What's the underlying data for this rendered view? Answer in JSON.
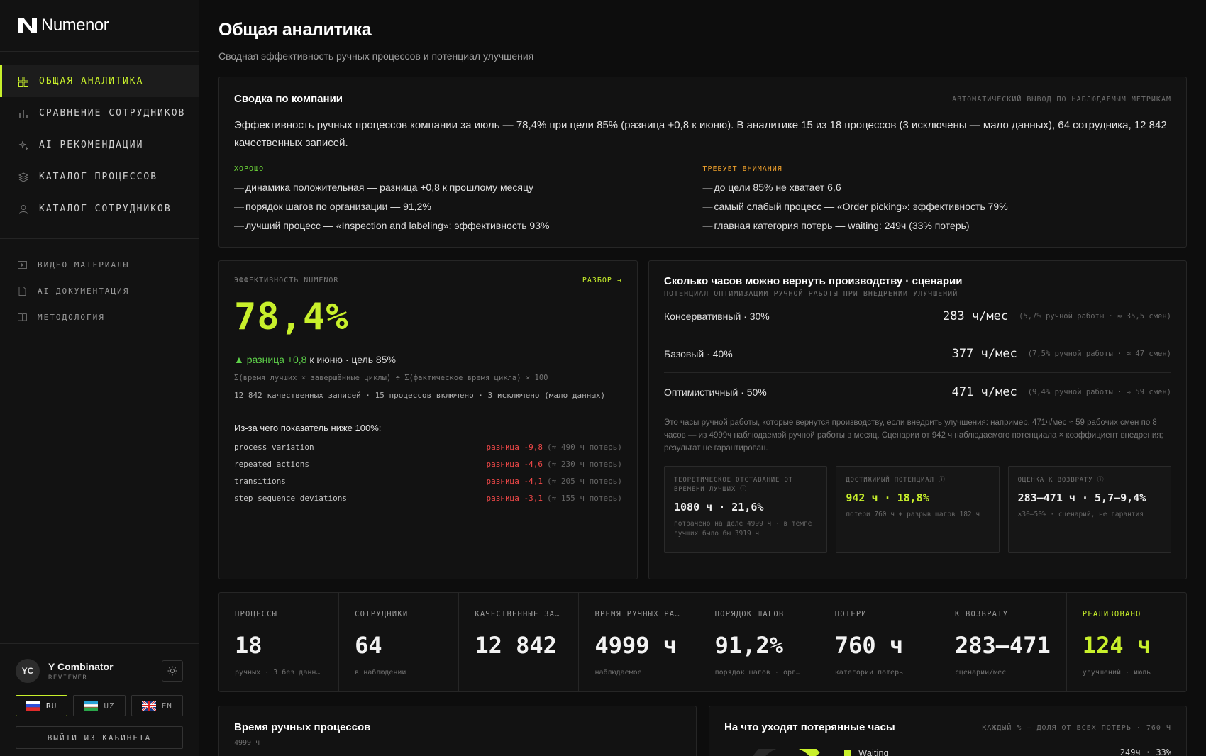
{
  "app": {
    "name": "Numenor"
  },
  "sidebar": {
    "nav": [
      {
        "label": "ОБЩАЯ АНАЛИТИКА",
        "icon": "grid-icon"
      },
      {
        "label": "СРАВНЕНИЕ СОТРУДНИКОВ",
        "icon": "bar-chart-icon"
      },
      {
        "label": "AI РЕКОМЕНДАЦИИ",
        "icon": "sparkle-icon"
      },
      {
        "label": "КАТАЛОГ ПРОЦЕССОВ",
        "icon": "layers-icon"
      },
      {
        "label": "КАТАЛОГ СОТРУДНИКОВ",
        "icon": "user-icon"
      }
    ],
    "sub": [
      {
        "label": "ВИДЕО МАТЕРИАЛЫ",
        "icon": "video-icon"
      },
      {
        "label": "AI ДОКУМЕНТАЦИЯ",
        "icon": "document-icon"
      },
      {
        "label": "МЕТОДОЛОГИЯ",
        "icon": "book-icon"
      }
    ],
    "user": {
      "initials": "YC",
      "name": "Y Combinator",
      "role": "REVIEWER"
    },
    "langs": [
      "RU",
      "UZ",
      "EN"
    ],
    "logout": "ВЫЙТИ ИЗ КАБИНЕТА"
  },
  "page": {
    "title": "Общая аналитика",
    "subtitle": "Сводная эффективность ручных процессов и потенциал улучшения"
  },
  "summary": {
    "title": "Сводка по компании",
    "tag": "АВТОМАТИЧЕСКИЙ ВЫВОД ПО НАБЛЮДАЕМЫМ МЕТРИКАМ",
    "text": "Эффективность ручных процессов компании за июль — 78,4% при цели 85% (разница +0,8 к июню). В аналитике 15 из 18 процессов (3 исключены — мало данных), 64 сотрудника, 12 842 качественных записей.",
    "good_title": "ХОРОШО",
    "good": [
      "динамика положительная — разница +0,8 к прошлому месяцу",
      "порядок шагов по организации — 91,2%",
      "лучший процесс — «Inspection and labeling»: эффективность 93%"
    ],
    "warn_title": "ТРЕБУЕТ ВНИМАНИЯ",
    "warn": [
      "до цели 85% не хватает 6,6",
      "самый слабый процесс — «Order picking»: эффективность 79%",
      "главная категория потерь — waiting: 249ч (33% потерь)"
    ]
  },
  "efficiency": {
    "label": "ЭФФЕКТИВНОСТЬ NUMENOR",
    "link": "РАЗБОР →",
    "value": "78,4%",
    "delta_arrow": "▲",
    "delta_text": "разница +0,8",
    "delta_rest": " к июню · цель 85%",
    "formula": "Σ(время лучших × завершённые циклы) ÷ Σ(фактическое время цикла) × 100",
    "meta": "12 842 качественных записей · 15 процессов включено · 3 исключено (мало данных)",
    "why_title": "Из-за чего показатель ниже 100%:",
    "why": [
      {
        "name": "process variation",
        "value": "разница -9,8",
        "note": "(≈ 490 ч потерь)"
      },
      {
        "name": "repeated actions",
        "value": "разница -4,6",
        "note": "(≈ 230 ч потерь)"
      },
      {
        "name": "transitions",
        "value": "разница -4,1",
        "note": "(≈ 205 ч потерь)"
      },
      {
        "name": "step sequence deviations",
        "value": "разница -3,1",
        "note": "(≈ 155 ч потерь)"
      }
    ]
  },
  "scenarios": {
    "title": "Сколько часов можно вернуть производству · сценарии",
    "subtitle": "ПОТЕНЦИАЛ ОПТИМИЗАЦИИ РУЧНОЙ РАБОТЫ ПРИ ВНЕДРЕНИИ УЛУЧШЕНИЙ",
    "rows": [
      {
        "name": "Консервативный · 30%",
        "value": "283 ч/мес",
        "note": "(5,7% ручной работы · ≈ 35,5 смен)"
      },
      {
        "name": "Базовый · 40%",
        "value": "377 ч/мес",
        "note": "(7,5% ручной работы · ≈ 47 смен)"
      },
      {
        "name": "Оптимистичный · 50%",
        "value": "471 ч/мес",
        "note": "(9,4% ручной работы · ≈ 59 смен)"
      }
    ],
    "note": "Это часы ручной работы, которые вернутся производству, если внедрить улучшения: например, 471ч/мес ≈ 59 рабочих смен по 8 часов — из 4999ч наблюдаемой ручной работы в месяц. Сценарии от 942 ч наблюдаемого потенциала × коэффициент внедрения; результат не гарантирован.",
    "cards": [
      {
        "label": "ТЕОРЕТИЧЕСКОЕ ОТСТАВАНИЕ ОТ ВРЕМЕНИ ЛУЧШИХ ⓘ",
        "value": "1080 ч · 21,6%",
        "sub": "потрачено на деле 4999 ч · в темпе лучших было бы 3919 ч"
      },
      {
        "label": "ДОСТИЖИМЫЙ ПОТЕНЦИАЛ ⓘ",
        "value": "942 ч · 18,8%",
        "sub": "потери 760 ч + разрыв шагов 182 ч"
      },
      {
        "label": "ОЦЕНКА К ВОЗВРАТУ ⓘ",
        "value": "283–471 ч · 5,7–9,4%",
        "sub": "×30–50% · сценарий, не гарантия"
      }
    ]
  },
  "kpis": [
    {
      "label": "ПРОЦЕССЫ",
      "value": "18",
      "sub": "ручных · 3 без данн…"
    },
    {
      "label": "СОТРУДНИКИ",
      "value": "64",
      "sub": "в наблюдении"
    },
    {
      "label": "КАЧЕСТВЕННЫЕ ЗА…",
      "value": "12 842",
      "sub": ""
    },
    {
      "label": "ВРЕМЯ РУЧНЫХ РА…",
      "value": "4999 ч",
      "sub": "наблюдаемое"
    },
    {
      "label": "ПОРЯДОК ШАГОВ",
      "value": "91,2%",
      "sub": "порядок шагов · орг…"
    },
    {
      "label": "ПОТЕРИ",
      "value": "760 ч",
      "sub": "категории потерь"
    },
    {
      "label": "К ВОЗВРАТУ",
      "value": "283–471",
      "sub": "сценарии/мес"
    },
    {
      "label": "РЕАЛИЗОВАНО",
      "value": "124 ч",
      "sub": "улучшений · июль"
    }
  ],
  "manual": {
    "title": "Время ручных процессов",
    "sub": "4999 ч"
  },
  "losses": {
    "title": "На что уходят потерянные часы",
    "tag": "КАЖДЫЙ % — ДОЛЯ ОТ ВСЕХ ПОТЕРЬ · 760 Ч",
    "legend": [
      {
        "name": "Waiting",
        "value": "249ч · 33%"
      }
    ],
    "accent": "#c8f02b"
  }
}
